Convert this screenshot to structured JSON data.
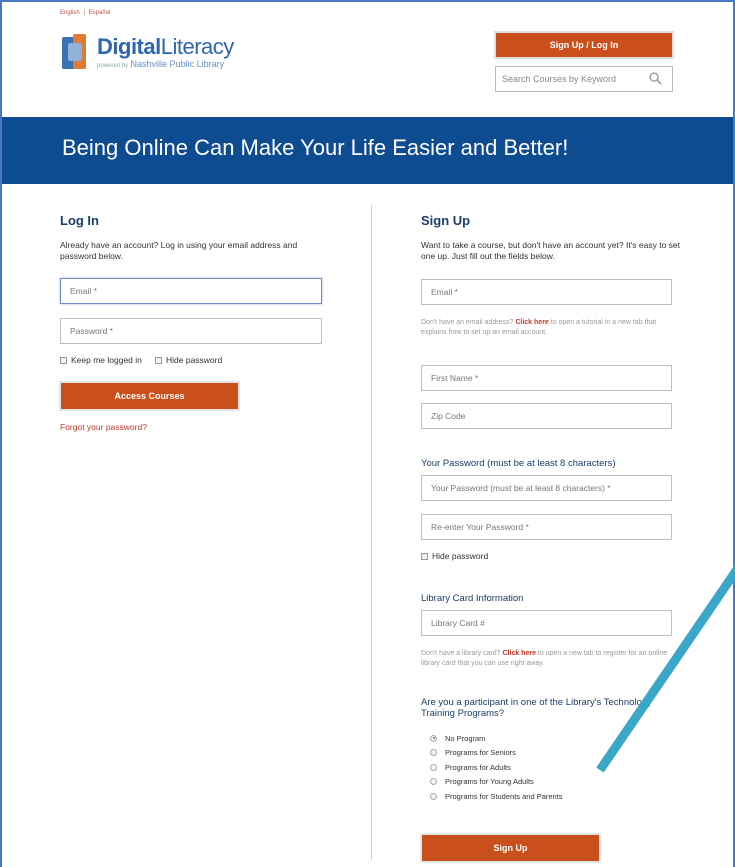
{
  "header": {
    "lang_english": "English",
    "lang_sep": "|",
    "lang_spanish": "Español",
    "logo_main": "Digital",
    "logo_main_b": "Literacy",
    "logo_sub_prefix": "powered by",
    "logo_sub": "Nashville Public Library",
    "signup_login": "Sign Up / Log In",
    "search_placeholder": "Search Courses by Keyword",
    "search_icon": "search-icon"
  },
  "hero": {
    "title": "Being Online Can Make Your Life Easier and Better!"
  },
  "login": {
    "heading": "Log In",
    "intro": "Already have an account? Log in using your email address and password below.",
    "email_placeholder": "Email *",
    "password_placeholder": "Password *",
    "keep_logged_in": "Keep me logged in",
    "hide_password": "Hide password",
    "access_button": "Access Courses",
    "forgot": "Forgot your password?"
  },
  "signup": {
    "heading": "Sign Up",
    "intro": "Want to take a course, but don't have an account yet? It's easy to set one up. Just fill out the fields below.",
    "email_placeholder": "Email *",
    "email_help_pre": "Don't have an email address? ",
    "email_help_link": "Click here",
    "email_help_post": " to open a tutorial in a new tab that explains how to set up an email account.",
    "first_name_placeholder": "First Name *",
    "zip_placeholder": "Zip Code",
    "password_section": "Your Password (must be at least 8 characters)",
    "password_placeholder": "Your Password (must be at least 8 characters) *",
    "reenter_placeholder": "Re-enter Your Password *",
    "hide_password": "Hide password",
    "library_section": "Library Card Information",
    "library_placeholder": "Library Card #",
    "library_help_pre": "Don't have a library card? ",
    "library_help_link": "Click here",
    "library_help_post": " to open a new tab to register for an online library card that you can use right away.",
    "question": "Are you a participant in one of the Library's Technology Training Programs?",
    "programs": [
      "No Program",
      "Programs for Seniors",
      "Programs for Adults",
      "Programs for Young Adults",
      "Programs for Students and Parents"
    ],
    "selected_program": "No Program",
    "submit": "Sign Up"
  },
  "colors": {
    "brand_orange": "#c94f1d",
    "hero_blue": "#0e4c92",
    "heading_navy": "#1a3d6b",
    "link_red": "#c0392b",
    "annotation_arrow": "#3aa6c8"
  }
}
